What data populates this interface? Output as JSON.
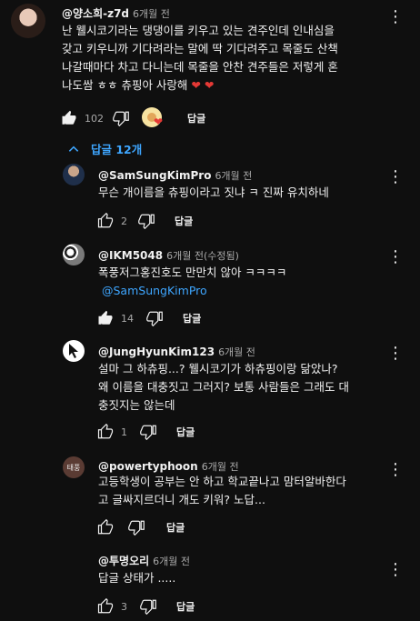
{
  "main_comment": {
    "author": "@양소희-z7d",
    "time": "6개월 전",
    "lines": [
      "난 웰시코기라는 댕댕이를 키우고 있는 견주인데 인내심을",
      "갖고 키우니까 기다려라는 말에 딱 기다려주고 목줄도 산책",
      "나갈때마다 차고 다니는데 목줄을 안찬 견주들은 저렇게 혼",
      "나도쌈 ㅎㅎ 츄핑아 사랑해"
    ],
    "hearts": "❤️ ❤️",
    "likes": "102",
    "reply_label": "답글"
  },
  "replies_toggle": {
    "label": "답글 12개",
    "color": "#3ea6ff"
  },
  "replies": [
    {
      "author": "@SamSungKimPro",
      "time": "6개월 전",
      "lines": [
        "무슨 개이름을 츄핑이라고 짓냐 ㅋ 진짜 유치하네"
      ],
      "likes": "2",
      "reply_label": "답글"
    },
    {
      "author": "@IKM5048",
      "time": "6개월 전(수정됨)",
      "lines": [
        "폭풍저그홍진호도 만만치 않아 ㅋㅋㅋㅋ"
      ],
      "mention": "@SamSungKimPro",
      "likes": "14",
      "reply_label": "답글"
    },
    {
      "author": "@JungHyunKim123",
      "time": "6개월 전",
      "lines": [
        "설마 그 하츄핑...? 웰시코기가 하츄핑이랑 닮았나?",
        "왜 이름을 대충짓고 그러지? 보통 사람들은 그래도 대",
        "충짓지는 않는데"
      ],
      "likes": "1",
      "reply_label": "답글"
    },
    {
      "author": "@powertyphoon",
      "time": "6개월 전",
      "avatar_text": "태풍",
      "lines": [
        "고등학생이 공부는 안 하고 학교끝나고 맘터알바한다",
        "고 글싸지르더니 개도 키워? 노답..."
      ],
      "likes": "",
      "reply_label": "답글"
    },
    {
      "author": "@투명오리",
      "time": "6개월 전",
      "lines": [
        "답글 상태가 ....."
      ],
      "likes": "3",
      "reply_label": "답글"
    }
  ],
  "colors": {
    "background": "#0f0f0f",
    "text": "#f1f1f1",
    "secondary": "#aaaaaa",
    "link": "#3ea6ff",
    "heart": "#e53935"
  },
  "icons": [
    "thumbs-up-icon",
    "thumbs-down-icon",
    "more-vert-icon",
    "chevron-up-icon",
    "creator-heart-icon"
  ]
}
